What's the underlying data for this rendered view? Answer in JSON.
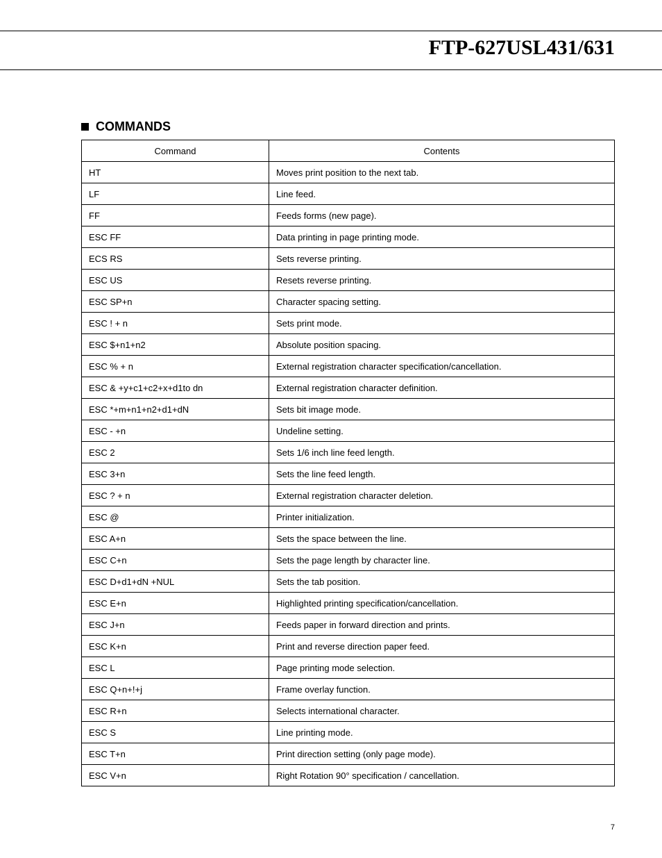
{
  "header": {
    "title": "FTP-627USL431/631"
  },
  "section": {
    "heading": "COMMANDS",
    "table": {
      "headers": {
        "command": "Command",
        "contents": "Contents"
      },
      "rows": [
        {
          "command": "HT",
          "contents": "Moves print position to the next tab."
        },
        {
          "command": "LF",
          "contents": "Line feed."
        },
        {
          "command": "FF",
          "contents": "Feeds forms (new page)."
        },
        {
          "command": "ESC FF",
          "contents": "Data printing in page printing mode."
        },
        {
          "command": "ECS RS",
          "contents": "Sets reverse printing."
        },
        {
          "command": "ESC US",
          "contents": "Resets reverse printing."
        },
        {
          "command": "ESC SP+n",
          "contents": "Character spacing setting."
        },
        {
          "command": "ESC ! + n",
          "contents": "Sets print mode."
        },
        {
          "command": "ESC $+n1+n2",
          "contents": "Absolute position spacing."
        },
        {
          "command": "ESC % + n",
          "contents": "External registration character specification/cancellation."
        },
        {
          "command": "ESC & +y+c1+c2+x+d1to dn",
          "contents": "External registration character definition."
        },
        {
          "command": "ESC *+m+n1+n2+d1+dN",
          "contents": "Sets bit image mode."
        },
        {
          "command": "ESC - +n",
          "contents": "Undeline setting."
        },
        {
          "command": "ESC 2",
          "contents": "Sets 1/6 inch line feed length."
        },
        {
          "command": "ESC 3+n",
          "contents": "Sets the line feed length."
        },
        {
          "command": "ESC ? + n",
          "contents": "External registration character deletion."
        },
        {
          "command": "ESC @",
          "contents": "Printer initialization."
        },
        {
          "command": "ESC A+n",
          "contents": "Sets the space between the line."
        },
        {
          "command": "ESC C+n",
          "contents": "Sets the page length by character line."
        },
        {
          "command": "ESC D+d1+dN +NUL",
          "contents": "Sets the tab position."
        },
        {
          "command": "ESC E+n",
          "contents": "Highlighted printing specification/cancellation."
        },
        {
          "command": "ESC J+n",
          "contents": "Feeds paper in forward direction and prints."
        },
        {
          "command": "ESC K+n",
          "contents": "Print and reverse direction paper feed."
        },
        {
          "command": "ESC L",
          "contents": "Page printing mode selection."
        },
        {
          "command": "ESC Q+n+!+j",
          "contents": "Frame overlay function."
        },
        {
          "command": "ESC R+n",
          "contents": "Selects international character."
        },
        {
          "command": "ESC S",
          "contents": "Line printing mode."
        },
        {
          "command": "ESC T+n",
          "contents": "Print direction setting (only page mode)."
        },
        {
          "command": "ESC V+n",
          "contents": "Right Rotation 90° specification / cancellation."
        }
      ]
    }
  },
  "footer": {
    "page_number": "7"
  }
}
